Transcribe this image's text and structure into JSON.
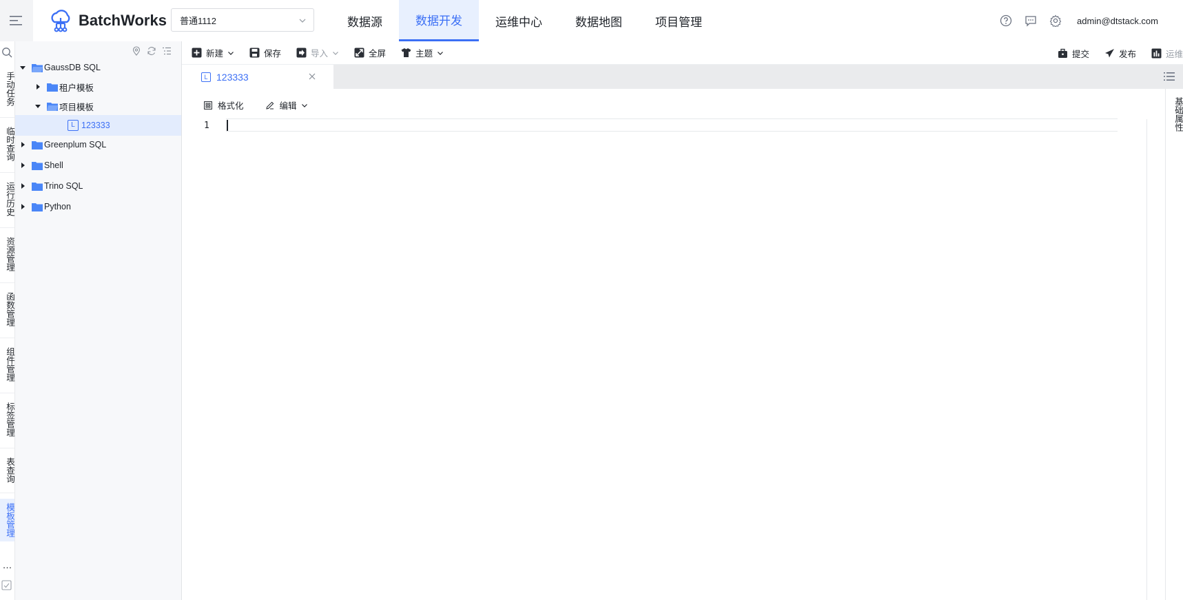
{
  "app": {
    "name": "BatchWorks"
  },
  "project_select": {
    "value": "普通1112"
  },
  "nav": [
    {
      "label": "数据源",
      "active": false
    },
    {
      "label": "数据开发",
      "active": true
    },
    {
      "label": "运维中心",
      "active": false
    },
    {
      "label": "数据地图",
      "active": false
    },
    {
      "label": "项目管理",
      "active": false
    }
  ],
  "user": {
    "email": "admin@dtstack.com"
  },
  "rail": {
    "items": [
      "手动任务",
      "临时查询",
      "运行历史",
      "资源管理",
      "函数管理",
      "组件管理",
      "标签管理",
      "表查询",
      "模板管理"
    ],
    "active": "模板管理",
    "more": "…"
  },
  "tree": {
    "nodes": [
      {
        "label": "GaussDB SQL",
        "expanded": true,
        "level": 0
      },
      {
        "label": "租户模板",
        "expanded": false,
        "level": 1
      },
      {
        "label": "项目模板",
        "expanded": true,
        "level": 1
      },
      {
        "label": "123333",
        "level": 2,
        "type": "file",
        "badge": "L",
        "selected": true
      },
      {
        "label": "Greenplum SQL",
        "expanded": false,
        "level": 0
      },
      {
        "label": "Shell",
        "expanded": false,
        "level": 0
      },
      {
        "label": "Trino SQL",
        "expanded": false,
        "level": 0
      },
      {
        "label": "Python",
        "expanded": false,
        "level": 0
      }
    ]
  },
  "toolbar": {
    "new_label": "新建",
    "save_label": "保存",
    "import_label": "导入",
    "fullscreen_label": "全屏",
    "theme_label": "主题",
    "submit_label": "提交",
    "publish_label": "发布",
    "ops_label": "运维"
  },
  "tab": {
    "label": "123333",
    "badge": "L"
  },
  "editor": {
    "format_label": "格式化",
    "edit_label": "编辑",
    "line_number": "1"
  },
  "properties": {
    "label": "基础属性"
  },
  "colors": {
    "accent": "#3b6ff5",
    "active_bg": "#e8f0fe",
    "folder": "#4a86f7"
  }
}
